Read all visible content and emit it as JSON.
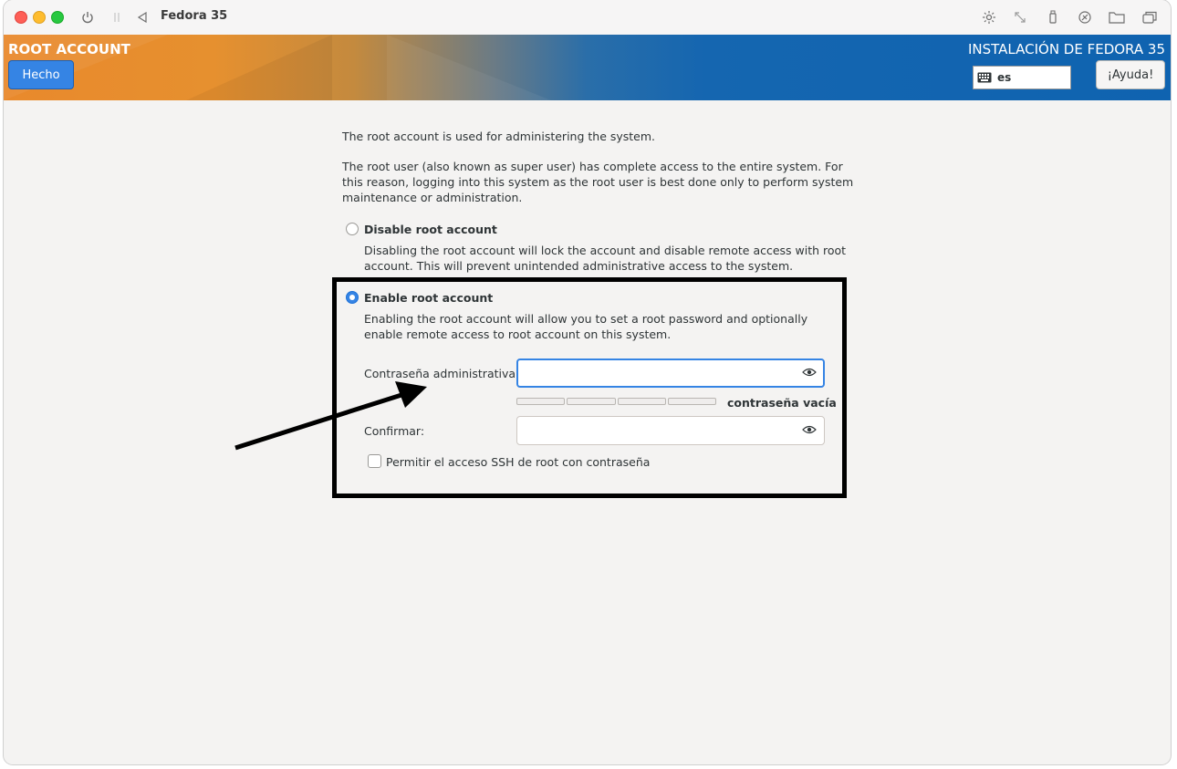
{
  "window": {
    "title": "Fedora 35"
  },
  "header": {
    "section_title": "ROOT ACCOUNT",
    "done_label": "Hecho",
    "install_title": "INSTALACIÓN DE FEDORA 35",
    "keyboard_layout": "es",
    "help_label": "¡Ayuda!"
  },
  "content": {
    "intro": "The root account is used for administering the system.",
    "description_lines": [
      "The root user (also known as super user) has complete access to the entire system. For",
      "this reason, logging into this system as the root user is best done only to perform system",
      "maintenance or administration."
    ],
    "disable_option": {
      "label": "Disable root account",
      "selected": false,
      "help_lines": [
        "Disabling the root account will lock the account and disable remote access with root",
        "account. This will prevent unintended administrative access to the system."
      ]
    },
    "enable_option": {
      "label": "Enable root account",
      "selected": true,
      "help_lines": [
        "Enabling the root account will allow you to set a root password and optionally",
        "enable remote access to root account on this system."
      ]
    },
    "password": {
      "label": "Contraseña administrativa:",
      "value": "",
      "strength_text": "contraseña vacía",
      "strength_level": 0
    },
    "confirm": {
      "label": "Confirmar:",
      "value": ""
    },
    "ssh_checkbox": {
      "label": "Permitir el acceso SSH de root con contraseña",
      "checked": false
    }
  },
  "icons": {
    "power": "power-icon",
    "pause": "pause-icon",
    "back": "back-icon",
    "brightness": "brightness-icon",
    "resize": "resize-icon",
    "usb": "usb-icon",
    "network": "network-icon",
    "folder": "folder-icon",
    "windows": "windows-icon",
    "eye": "eye-icon",
    "keyboard": "keyboard-icon"
  }
}
